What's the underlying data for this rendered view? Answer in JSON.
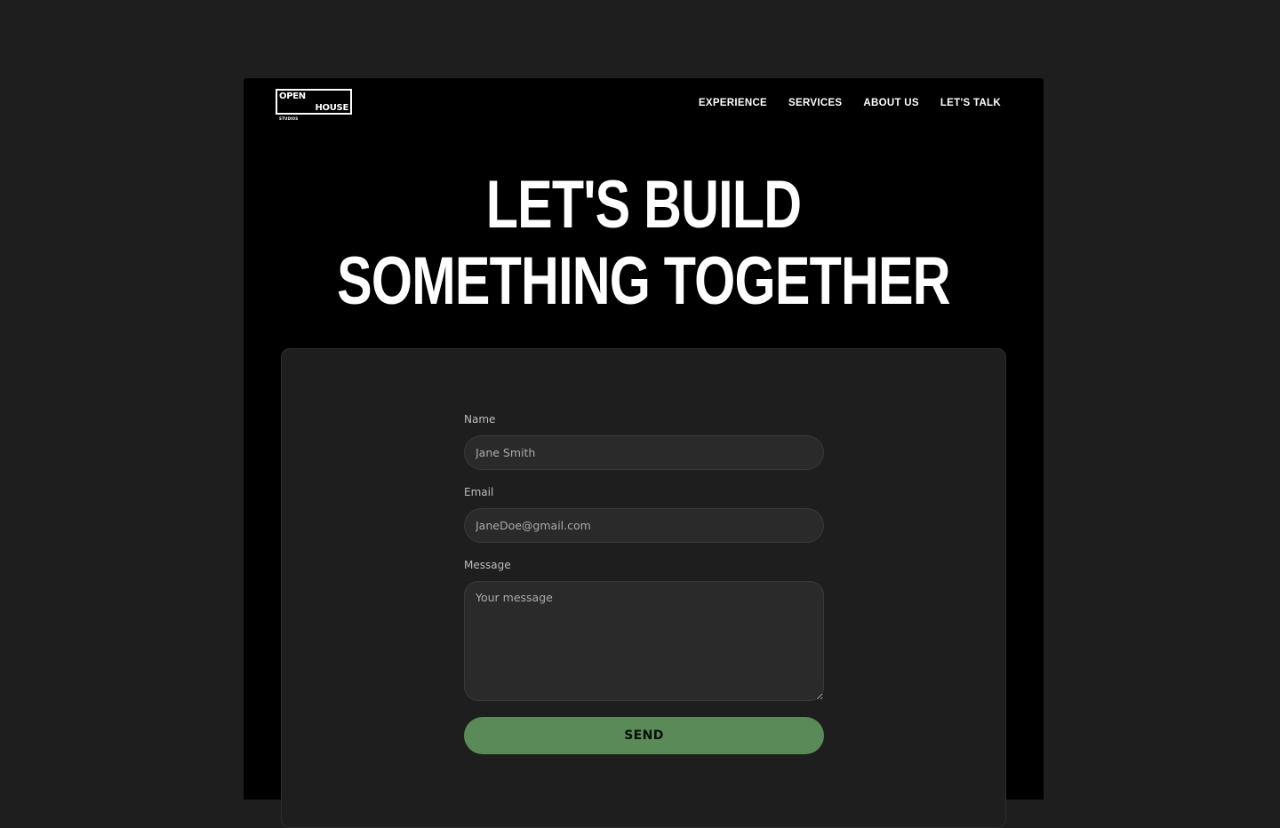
{
  "logo": {
    "line1": "OPEN",
    "line2": "HOUSE",
    "line3": "STUDIOS"
  },
  "nav": {
    "items": [
      {
        "label": "EXPERIENCE"
      },
      {
        "label": "SERVICES"
      },
      {
        "label": "ABOUT US"
      },
      {
        "label": "LET'S TALK"
      }
    ]
  },
  "hero": {
    "line1": "LET'S BUILD",
    "line2": "SOMETHING TOGETHER"
  },
  "form": {
    "name_label": "Name",
    "name_placeholder": "Jane Smith",
    "email_label": "Email",
    "email_placeholder": "JaneDoe@gmail.com",
    "message_label": "Message",
    "message_placeholder": "Your message",
    "submit_label": "SEND"
  },
  "colors": {
    "page_bg": "#1e1e1e",
    "frame_bg": "#000000",
    "card_bg": "#1e1e1e",
    "input_bg": "#2a2a2a",
    "accent": "#5a8a58",
    "text": "#ffffff"
  }
}
